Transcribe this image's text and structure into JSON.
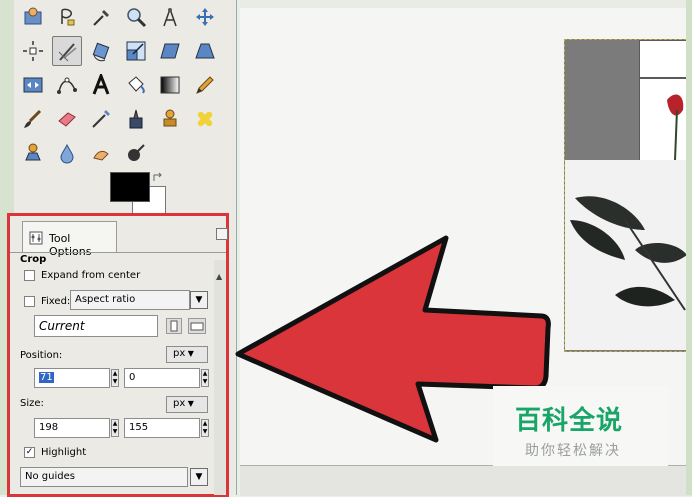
{
  "colors": {
    "arrow": "#d9353b",
    "panel_highlight": "#d9353b",
    "foreground": "#000000",
    "background": "#ffffff",
    "watermark_green": "#1aa568"
  },
  "toolbox": {
    "tools": [
      {
        "name": "rect-select-tool",
        "icon": "rect-select-icon"
      },
      {
        "name": "lasso-tool",
        "icon": "lasso-icon"
      },
      {
        "name": "color-picker-tool",
        "icon": "color-picker-icon"
      },
      {
        "name": "zoom-tool",
        "icon": "magnifier-icon"
      },
      {
        "name": "measure-tool",
        "icon": "compass-icon"
      },
      {
        "name": "move-tool",
        "icon": "move-arrows-icon"
      },
      {
        "name": "align-tool",
        "icon": "align-icon"
      },
      {
        "name": "crop-tool",
        "icon": "crop-knife-icon",
        "active": true
      },
      {
        "name": "rotate-tool",
        "icon": "rotate-icon"
      },
      {
        "name": "scale-tool",
        "icon": "scale-icon"
      },
      {
        "name": "shear-tool",
        "icon": "shear-icon"
      },
      {
        "name": "perspective-tool",
        "icon": "perspective-icon"
      },
      {
        "name": "flip-tool",
        "icon": "flip-icon"
      },
      {
        "name": "path-tool",
        "icon": "path-icon"
      },
      {
        "name": "text-tool",
        "icon": "text-a-icon"
      },
      {
        "name": "bucket-fill-tool",
        "icon": "bucket-icon"
      },
      {
        "name": "blend-tool",
        "icon": "gradient-icon"
      },
      {
        "name": "pencil-tool",
        "icon": "pencil-icon"
      },
      {
        "name": "paintbrush-tool",
        "icon": "brush-icon"
      },
      {
        "name": "eraser-tool",
        "icon": "eraser-icon"
      },
      {
        "name": "airbrush-tool",
        "icon": "airbrush-icon"
      },
      {
        "name": "ink-tool",
        "icon": "ink-icon"
      },
      {
        "name": "clone-tool",
        "icon": "stamp-icon"
      },
      {
        "name": "heal-tool",
        "icon": "bandage-icon"
      },
      {
        "name": "perspective-clone-tool",
        "icon": "perspective-clone-icon"
      },
      {
        "name": "blur-tool",
        "icon": "droplet-icon"
      },
      {
        "name": "smudge-tool",
        "icon": "smudge-icon"
      },
      {
        "name": "dodge-burn-tool",
        "icon": "dodge-burn-icon"
      }
    ]
  },
  "tool_options": {
    "tab_label": "Tool Options",
    "section": "Crop",
    "expand_from_center": "Expand from center",
    "fixed_label": "Fixed:",
    "fixed_value": "Aspect ratio",
    "current_value": "Current",
    "position_label": "Position:",
    "position_unit": "px",
    "position_x": "71",
    "position_y": "0",
    "size_label": "Size:",
    "size_unit": "px",
    "size_w": "198",
    "size_h": "155",
    "highlight_label": "Highlight",
    "highlight_checked": true,
    "guides_value": "No guides"
  },
  "watermark": {
    "title": "百科全说",
    "subtitle": "助你轻松解决"
  }
}
